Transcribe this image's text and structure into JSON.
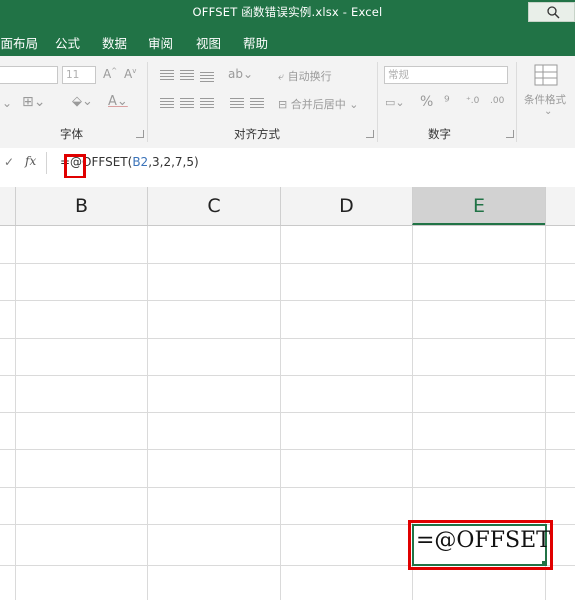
{
  "window": {
    "title": "OFFSET 函数错误实例.xlsx  -  Excel"
  },
  "menu": {
    "tabs": [
      "页面布局",
      "公式",
      "数据",
      "审阅",
      "视图",
      "帮助"
    ]
  },
  "ribbon": {
    "font_size": "11",
    "wrap_text": "自动换行",
    "merge_center": "合并后居中",
    "number_format": "常规",
    "conditional_format": "条件格式",
    "groups": {
      "font": "字体",
      "alignment": "对齐方式",
      "number": "数字"
    }
  },
  "formula_bar": {
    "fx_label": "fx",
    "formula_prefix": "=@OFFSET(",
    "formula_ref": "B2",
    "formula_suffix": ",3,2,7,5)"
  },
  "sheet": {
    "columns": [
      "B",
      "C",
      "D",
      "E"
    ],
    "active_column": "E",
    "active_cell_value": "=@OFFSET"
  },
  "colors": {
    "excel_green": "#217346",
    "highlight_red": "#e00000",
    "ref_blue": "#3b73b9"
  }
}
